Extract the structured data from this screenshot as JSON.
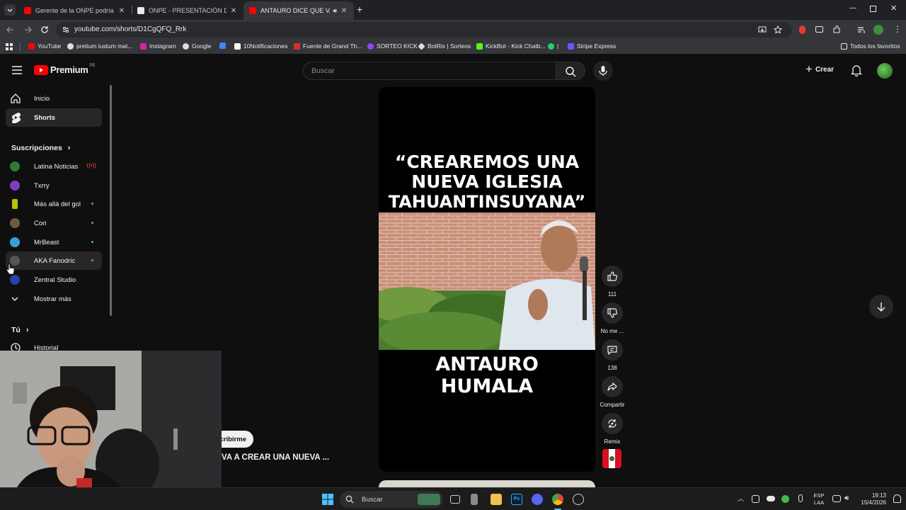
{
  "browser": {
    "tabs": [
      {
        "title": "Gerente de la ONPE podría seg",
        "color": "#ff0000"
      },
      {
        "title": "ONPE - PRESENTACIÓN DE RES",
        "color": "#e8eaed"
      },
      {
        "title": "ANTAURO DICE QUE VA A",
        "color": "#ff0000",
        "active": true
      }
    ],
    "url": "youtube.com/shorts/D1CgQFQ_Rrk",
    "bookmarks": [
      {
        "label": "YouTube",
        "color": "#ff0000"
      },
      {
        "label": "pretium iustum mat...",
        "color": "#dddddd"
      },
      {
        "label": "Instagram",
        "color": "#d6249f"
      },
      {
        "label": "Google",
        "color": "#dddddd"
      },
      {
        "label": "",
        "color": "#4285f4"
      },
      {
        "label": "10Notificaciones",
        "color": "#ffffff"
      },
      {
        "label": "Fuente de Grand Th...",
        "color": "#d93025"
      },
      {
        "label": "SORTEO KICK",
        "color": "#9146ff"
      },
      {
        "label": "BotRix | Sorteos",
        "color": "#dddddd"
      },
      {
        "label": "KickBot - Kick Chatb...",
        "color": "#53fc18"
      },
      {
        "label": "|",
        "color": "#25d366"
      },
      {
        "label": "Stripe Express",
        "color": "#635bff"
      }
    ],
    "all_favorites": "Todos los favoritos"
  },
  "youtube": {
    "logo_text": "Premium",
    "region": "PE",
    "search_placeholder": "Buscar",
    "create_label": "Crear",
    "nav": [
      {
        "label": "Inicio"
      },
      {
        "label": "Shorts"
      }
    ],
    "subscriptions_header": "Suscripciones",
    "subscriptions": [
      {
        "label": "Latina Noticias",
        "color": "#2e7d32",
        "live": true
      },
      {
        "label": "Txrry",
        "color": "#7b3fbf"
      },
      {
        "label": "Más allá del gol",
        "color": "#b8c400"
      },
      {
        "label": "Cori",
        "color": "#6d5b45"
      },
      {
        "label": "MrBeast",
        "color": "#3a9fd8"
      },
      {
        "label": "AKA Fanodric",
        "color": "#555555"
      },
      {
        "label": "Zentral Studio",
        "color": "#2a3fa8"
      }
    ],
    "show_more": "Mostrar más",
    "you_header": "Tú",
    "history": "Historial"
  },
  "short": {
    "caption_top": [
      "“CREAREMOS UNA",
      "NUEVA IGLESIA",
      "TAHUANTINSUYANA”"
    ],
    "caption_bottom": [
      "ANTAURO",
      "HUMALA"
    ],
    "likes": "111",
    "dislike_label": "No me ...",
    "comments": "138",
    "share_label": "Compartir",
    "remix_label": "Remix",
    "subscribe_label": "cribirme",
    "title": "VA A CREAR UNA NUEVA ..."
  },
  "taskbar": {
    "search": "Buscar",
    "language": [
      "ESP",
      "LAA"
    ],
    "time": "19:13",
    "date": "15/4/2026"
  }
}
